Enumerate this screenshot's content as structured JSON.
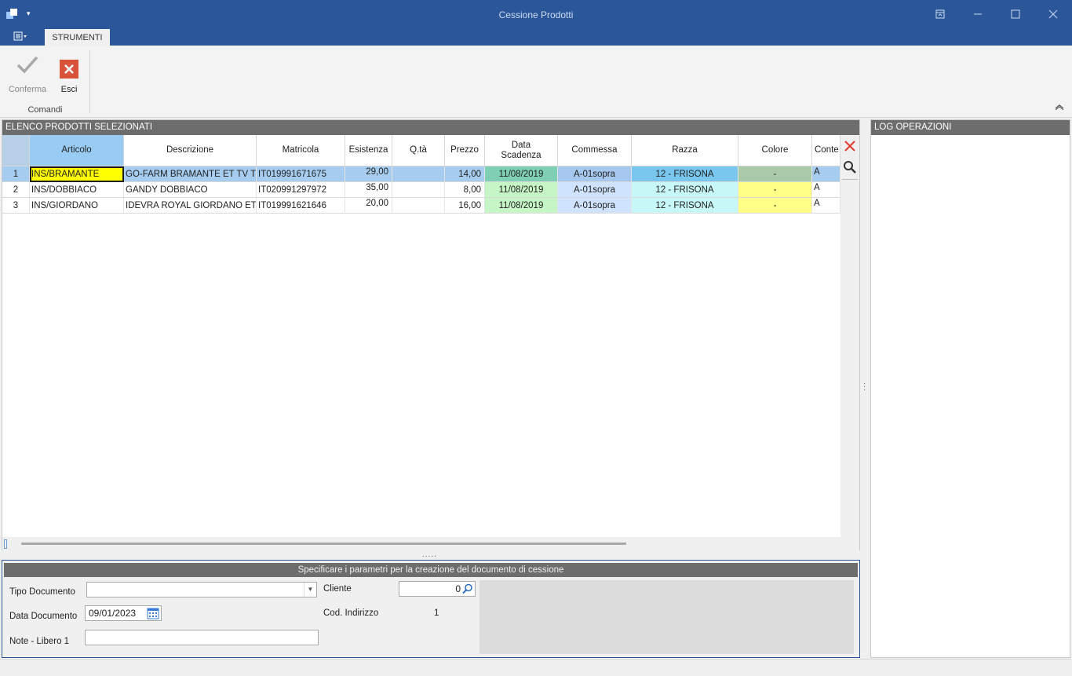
{
  "window": {
    "title": "Cessione Prodotti"
  },
  "ribbon": {
    "tab_label": "STRUMENTI",
    "buttons": {
      "confirm": "Conferma",
      "exit": "Esci"
    },
    "group_label": "Comandi"
  },
  "products_panel": {
    "title": "ELENCO PRODOTTI SELEZIONATI",
    "columns": [
      "Articolo",
      "Descrizione",
      "Matricola",
      "Esistenza",
      "Q.tà",
      "Prezzo",
      "Data\nScadenza",
      "Commessa",
      "Razza",
      "Colore",
      "Conte"
    ],
    "rows": [
      {
        "n": "1",
        "articolo": "INS/BRAMANTE",
        "descrizione": "GO-FARM BRAMANTE ET TV TL TY",
        "matricola": "IT019991671675",
        "esistenza": "29,00",
        "qta": "",
        "prezzo": "14,00",
        "scadenza": "11/08/2019",
        "commessa": "A-01sopra",
        "razza": "12 - FRISONA",
        "colore": "-",
        "conte": "A"
      },
      {
        "n": "2",
        "articolo": "INS/DOBBIACO",
        "descrizione": "GANDY DOBBIACO",
        "matricola": "IT020991297972",
        "esistenza": "35,00",
        "qta": "",
        "prezzo": "8,00",
        "scadenza": "11/08/2019",
        "commessa": "A-01sopra",
        "razza": "12 - FRISONA",
        "colore": "-",
        "conte": "A"
      },
      {
        "n": "3",
        "articolo": "INS/GIORDANO",
        "descrizione": "IDEVRA ROYAL GIORDANO ET TV TL",
        "matricola": "IT019991621646",
        "esistenza": "20,00",
        "qta": "",
        "prezzo": "16,00",
        "scadenza": "11/08/2019",
        "commessa": "A-01sopra",
        "razza": "12 - FRISONA",
        "colore": "-",
        "conte": "A"
      }
    ]
  },
  "params_panel": {
    "banner": "Specificare i parametri per la creazione del documento di cessione",
    "tipo_documento_label": "Tipo Documento",
    "tipo_documento_value": "",
    "data_documento_label": "Data Documento",
    "data_documento_value": "09/01/2023",
    "note_label": "Note - Libero 1",
    "note_value": "",
    "cliente_label": "Cliente",
    "cliente_value": "0",
    "cod_indirizzo_label": "Cod. Indirizzo",
    "cod_indirizzo_value": "1"
  },
  "log_panel": {
    "title": "LOG OPERAZIONI"
  },
  "colors": {
    "accent": "#2b579a",
    "selected_header": "#99ccf4",
    "active_cell": "#ffff00",
    "date_cell": "#c6f5c6",
    "commessa_cell": "#cfe3ff",
    "razza_cell": "#c8f7f7",
    "colore_cell": "#ffff88",
    "delete_icon": "#e23b2e"
  }
}
